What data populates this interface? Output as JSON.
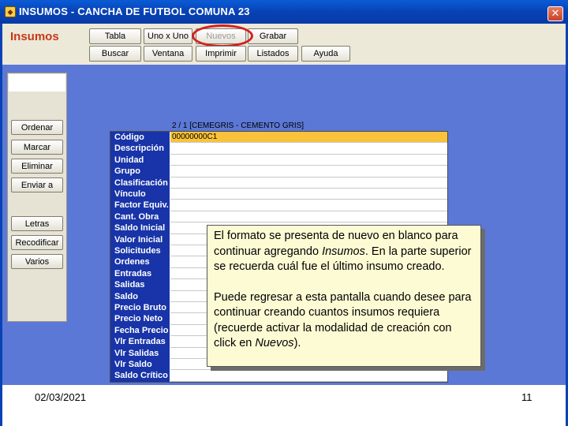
{
  "window": {
    "title": "INSUMOS - CANCHA DE FUTBOL COMUNA 23",
    "close_glyph": "✕"
  },
  "header": {
    "brand": "Insumos",
    "buttons_row1": [
      "Tabla",
      "Uno x Uno",
      "Nuevos",
      "Grabar"
    ],
    "buttons_row2": [
      "Buscar",
      "Ventana",
      "Imprimir",
      "Listados",
      "Ayuda"
    ]
  },
  "sidebar": {
    "group1": [
      "Ordenar",
      "Marcar",
      "Eliminar",
      "Enviar a"
    ],
    "group2": [
      "Letras",
      "Recodificar",
      "Varios"
    ]
  },
  "record": {
    "header": "2 / 1   [CEMEGRIS - CEMENTO GRIS]",
    "fields": [
      {
        "label": "Código",
        "value": "00000000C1"
      },
      {
        "label": "Descripción",
        "value": ""
      },
      {
        "label": "Unidad",
        "value": ""
      },
      {
        "label": "Grupo",
        "value": ""
      },
      {
        "label": "Clasificación",
        "value": ""
      },
      {
        "label": "Vínculo",
        "value": ""
      },
      {
        "label": "Factor Equiv.",
        "value": ""
      },
      {
        "label": "Cant. Obra",
        "value": ""
      },
      {
        "label": "Saldo Inicial",
        "value": ""
      },
      {
        "label": "Valor Inicial",
        "value": ""
      },
      {
        "label": "Solicitudes",
        "value": ""
      },
      {
        "label": "Ordenes",
        "value": ""
      },
      {
        "label": "Entradas",
        "value": ""
      },
      {
        "label": "Salidas",
        "value": ""
      },
      {
        "label": "Saldo",
        "value": ""
      },
      {
        "label": "Precio Bruto",
        "value": ""
      },
      {
        "label": "Precio Neto",
        "value": ""
      },
      {
        "label": "Fecha Precio",
        "value": ""
      },
      {
        "label": "Vlr Entradas",
        "value": ""
      },
      {
        "label": "Vlr Salidas",
        "value": ""
      },
      {
        "label": "Vlr Saldo",
        "value": ""
      },
      {
        "label": "Saldo Crítico",
        "value": ""
      }
    ]
  },
  "callout": {
    "p1_a": "El formato se presenta de nuevo en blanco para continuar agregando ",
    "p1_em": "Insumos",
    "p1_b": ". En la parte superior se recuerda cuál fue el último insumo creado.",
    "p2_a": "Puede regresar a esta pantalla cuando desee para continuar creando cuantos insumos requiera (recuerde activar la modalidad de creación con click en ",
    "p2_em": "Nuevos",
    "p2_b": ")."
  },
  "footer": {
    "date": "02/03/2021",
    "page": "11"
  },
  "colors": {
    "titlebar": "#0842b5",
    "canvas": "#5b78d6",
    "label_bg": "#1834a8",
    "active_field": "#f9c23a",
    "callout_bg": "#fdfbd4",
    "highlight_ring": "#d22020",
    "brand": "#c83818"
  },
  "icons": {
    "app": "app-icon",
    "close": "close-icon"
  }
}
